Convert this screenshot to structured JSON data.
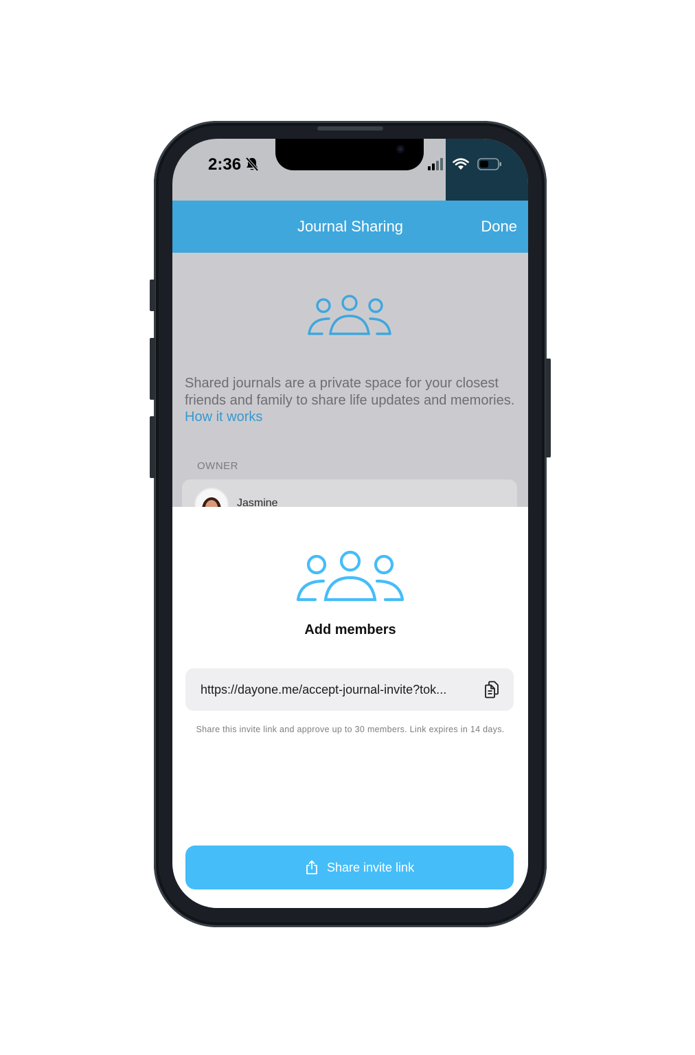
{
  "status_bar": {
    "time": "2:36",
    "icons": [
      "bell-slash-icon",
      "signal-icon",
      "wifi-icon",
      "battery-icon"
    ]
  },
  "nav": {
    "title": "Journal Sharing",
    "done_label": "Done"
  },
  "intro": {
    "description": "Shared journals are a private space for your closest friends and family to share life updates and memories.",
    "link_label": "How it works"
  },
  "owner": {
    "section_label": "OWNER",
    "name": "Jasmine"
  },
  "sheet": {
    "title": "Add members",
    "invite_link": "https://dayone.me/accept-journal-invite?tok...",
    "helper_text": "Share this invite link and approve up to 30 members. Link expires in 14 days.",
    "share_button_label": "Share invite link"
  },
  "colors": {
    "nav_blue": "#3fa7dc",
    "button_blue": "#45bdf8",
    "link_blue": "#3798d0",
    "sheet_icon_blue": "#45bdf8"
  }
}
